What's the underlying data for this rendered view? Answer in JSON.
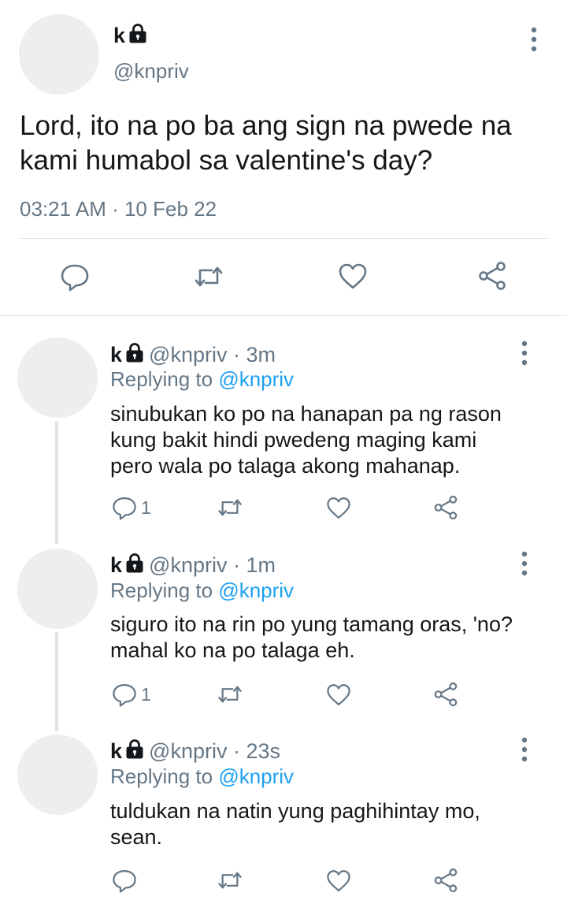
{
  "main_tweet": {
    "name": "k",
    "handle": "@knpriv",
    "text_line1": "Lord, ito na po ba ang sign na pwede na",
    "text_line2": "kami humabol sa valentine's day?",
    "timestamp": "03:21 AM · 10 Feb 22",
    "icons": [
      "comment-icon",
      "retweet-icon",
      "like-icon",
      "share-icon",
      "more-icon",
      "lock-icon"
    ]
  },
  "replies": [
    {
      "name": "k",
      "handle": "@knpriv · 3m",
      "replying_prefix": "Replying to ",
      "replying_handle": "@knpriv",
      "text_line1": "sinubukan ko po na hanapan pa ng rason",
      "text_line2": "kung bakit hindi pwedeng maging kami",
      "text_line3": "pero wala po talaga akong mahanap.",
      "comment_count": "1"
    },
    {
      "name": "k",
      "handle": "@knpriv · 1m",
      "replying_prefix": "Replying to ",
      "replying_handle": "@knpriv",
      "text_line1": "siguro ito na rin po yung tamang oras, 'no?",
      "text_line2": "mahal ko na po talaga eh.",
      "comment_count": "1"
    },
    {
      "name": "k",
      "handle": "@knpriv · 23s",
      "replying_prefix": "Replying to ",
      "replying_handle": "@knpriv",
      "text_line1": "tuldukan na natin yung paghihintay mo,",
      "text_line2": "sean."
    }
  ],
  "colors": {
    "text": "#14171a",
    "secondary": "#657786",
    "link": "#1da1f2",
    "divider": "#e1e5e8"
  }
}
